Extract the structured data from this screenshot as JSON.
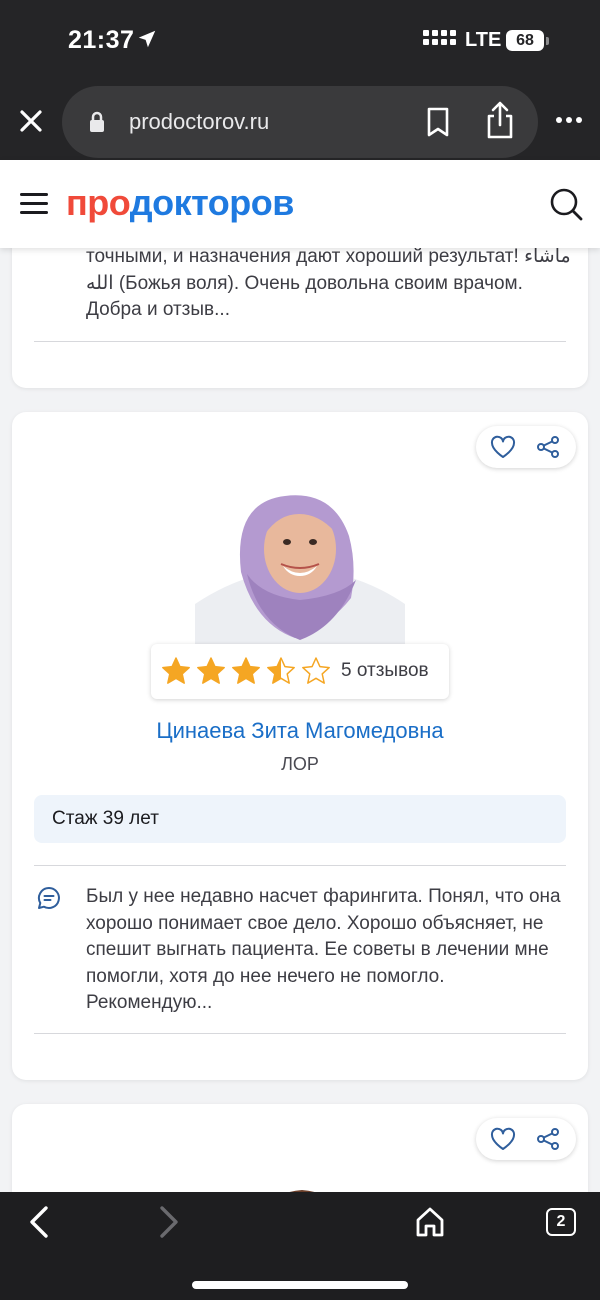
{
  "status_bar": {
    "time": "21:37",
    "network": "LTE",
    "battery": "68"
  },
  "browser": {
    "url": "prodoctorov.ru",
    "tab_count": "2"
  },
  "site": {
    "logo_part1": "про",
    "logo_part2": "докторов"
  },
  "cards": [
    {
      "review_text": "точными, и назначения дают хороший результат! ماشاء الله (Божья воля). Очень довольна своим врачом. Добра и отзыв..."
    },
    {
      "rating": 3.5,
      "reviews_count": "5 отзывов",
      "doctor_name": "Цинаева Зита Магомедовна",
      "specialty": "ЛОР",
      "experience": "Стаж 39 лет",
      "review_text": "Был у нее недавно насчет фарингита. Понял, что она хорошо понимает свое дело. Хорошо объясняет, не спешит выгнать пациента. Ее советы в лечении мне помогли, хотя до нее нечего не помогло. Рекомендую..."
    }
  ],
  "colors": {
    "brand_red": "#f04a3a",
    "brand_blue": "#1f7ae0",
    "star": "#f5a623",
    "link": "#1a6ec7"
  },
  "icons": [
    "location-arrow-icon",
    "signal-icon",
    "close-icon",
    "lock-icon",
    "bookmark-icon",
    "share-icon",
    "more-icon",
    "menu-icon",
    "search-icon",
    "heart-icon",
    "share-nodes-icon",
    "comment-icon",
    "back-icon",
    "forward-icon",
    "home-icon",
    "tabs-icon"
  ]
}
